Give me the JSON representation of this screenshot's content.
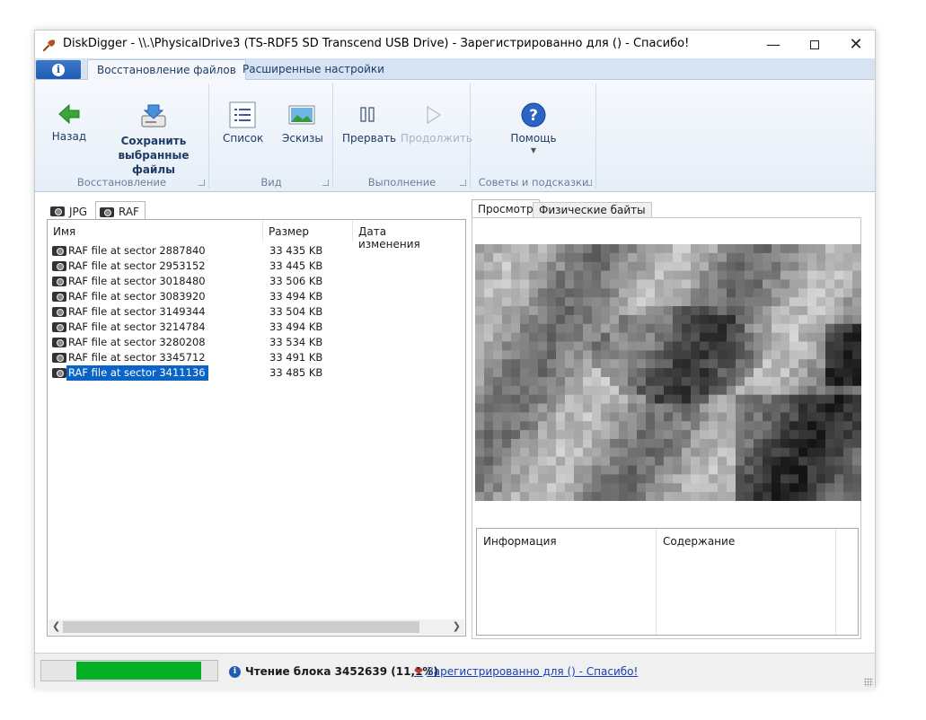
{
  "window": {
    "title": "DiskDigger - \\\\.\\PhysicalDrive3 (TS-RDF5 SD  Transcend USB Drive) - Зарегистрированно для  () - Спасибо!"
  },
  "ribbon": {
    "tabs": [
      {
        "label": "Восстановление файлов"
      },
      {
        "label": "Расширенные настройки"
      }
    ],
    "groups": {
      "restore": {
        "label": "Восстановление",
        "back_label": "Назад",
        "save_line1": "Сохранить",
        "save_line2": "выбранные",
        "save_line3": "файлы"
      },
      "view": {
        "label": "Вид",
        "list_label": "Список",
        "thumbs_label": "Эскизы"
      },
      "run": {
        "label": "Выполнение",
        "pause_label": "Прервать",
        "continue_label": "Продолжить"
      },
      "tips": {
        "label": "Советы и подсказки",
        "help_label": "Помощь"
      }
    }
  },
  "file_tabs": [
    {
      "label": "JPG"
    },
    {
      "label": "RAF"
    }
  ],
  "file_list": {
    "columns": [
      "Имя",
      "Размер",
      "Дата изменения"
    ],
    "rows": [
      {
        "name": "RAF file at sector 2887840",
        "size": "33 435 KB"
      },
      {
        "name": "RAF file at sector 2953152",
        "size": "33 445 KB"
      },
      {
        "name": "RAF file at sector 3018480",
        "size": "33 506 KB"
      },
      {
        "name": "RAF file at sector 3083920",
        "size": "33 494 KB"
      },
      {
        "name": "RAF file at sector 3149344",
        "size": "33 504 KB"
      },
      {
        "name": "RAF file at sector 3214784",
        "size": "33 494 KB"
      },
      {
        "name": "RAF file at sector 3280208",
        "size": "33 534 KB"
      },
      {
        "name": "RAF file at sector 3345712",
        "size": "33 491 KB"
      },
      {
        "name": "RAF file at sector 3411136",
        "size": "33 485 KB"
      }
    ]
  },
  "preview": {
    "tabs": [
      {
        "label": "Просмотр"
      },
      {
        "label": "Физические байты"
      }
    ],
    "info_columns": [
      "Информация",
      "Содержание"
    ]
  },
  "status": {
    "progress_percent": 11.1,
    "message": "Чтение блока 3452639 (11,1%)",
    "link": "Зарегистрированно для  () - Спасибо!"
  },
  "colors": {
    "selection": "#0a64c8",
    "progress": "#06b025",
    "ribbon_tab_bg": "#d5e3f3"
  }
}
